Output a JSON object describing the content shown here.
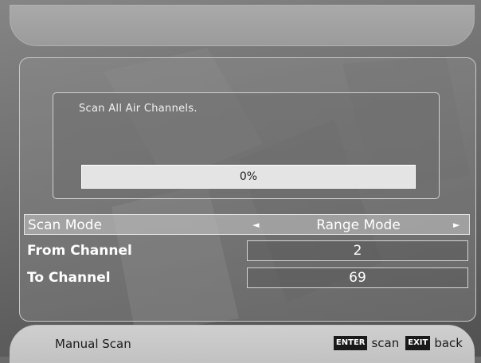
{
  "info": {
    "message": "Scan All Air Channels.",
    "progress_percent": 0,
    "progress_label": "0%"
  },
  "settings": {
    "scan_mode": {
      "label": "Scan Mode",
      "value": "Range Mode",
      "left_arrow": "◄",
      "right_arrow": "►"
    },
    "from_channel": {
      "label": "From Channel",
      "value": "2"
    },
    "to_channel": {
      "label": "To Channel",
      "value": "69"
    }
  },
  "footer": {
    "title": "Manual Scan",
    "hints": [
      {
        "key": "ENTER",
        "action": "scan"
      },
      {
        "key": "EXIT",
        "action": "back"
      }
    ]
  },
  "colors": {
    "panel_border": "#cfcfcf",
    "progress_track": "#e4e4e4",
    "key_badge": "#1a1a1a"
  }
}
